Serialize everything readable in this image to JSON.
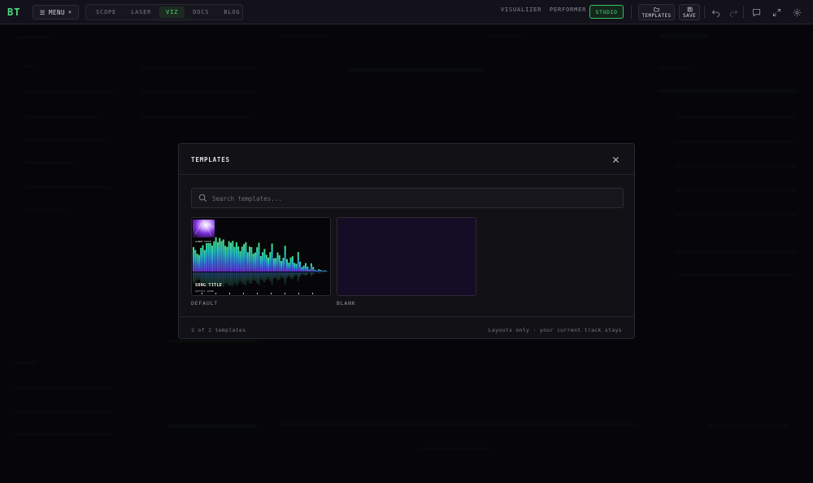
{
  "app": {
    "logo": "BT",
    "menu_label": "MENU",
    "nav_tabs": [
      "SCOPE",
      "LASER",
      "VIZ",
      "DOCS",
      "BLOG"
    ],
    "active_nav_tab": "VIZ",
    "modes": [
      "VISUALIZER",
      "PERFORMER",
      "STUDIO"
    ],
    "active_mode": "STUDIO",
    "toolbar": {
      "templates_label": "TEMPLATES",
      "save_label": "SAVE"
    },
    "icons": [
      "folder-icon",
      "save-icon",
      "undo-icon",
      "redo-icon",
      "chat-icon",
      "expand-icon",
      "gear-icon"
    ],
    "accent_color": "#4ade80"
  },
  "modal": {
    "title": "TEMPLATES",
    "search_placeholder": "Search templates...",
    "templates": [
      {
        "label": "DEFAULT",
        "preview": {
          "song_title": "SONG TITLE",
          "artist_name": "ARTIST NAME",
          "album_label": "ALBUM TITLE"
        }
      },
      {
        "label": "BLANK",
        "preview_color": "#150c26"
      }
    ],
    "footer_count": "2 of 2 templates",
    "footer_note": "Layouts only · your current track stays"
  }
}
